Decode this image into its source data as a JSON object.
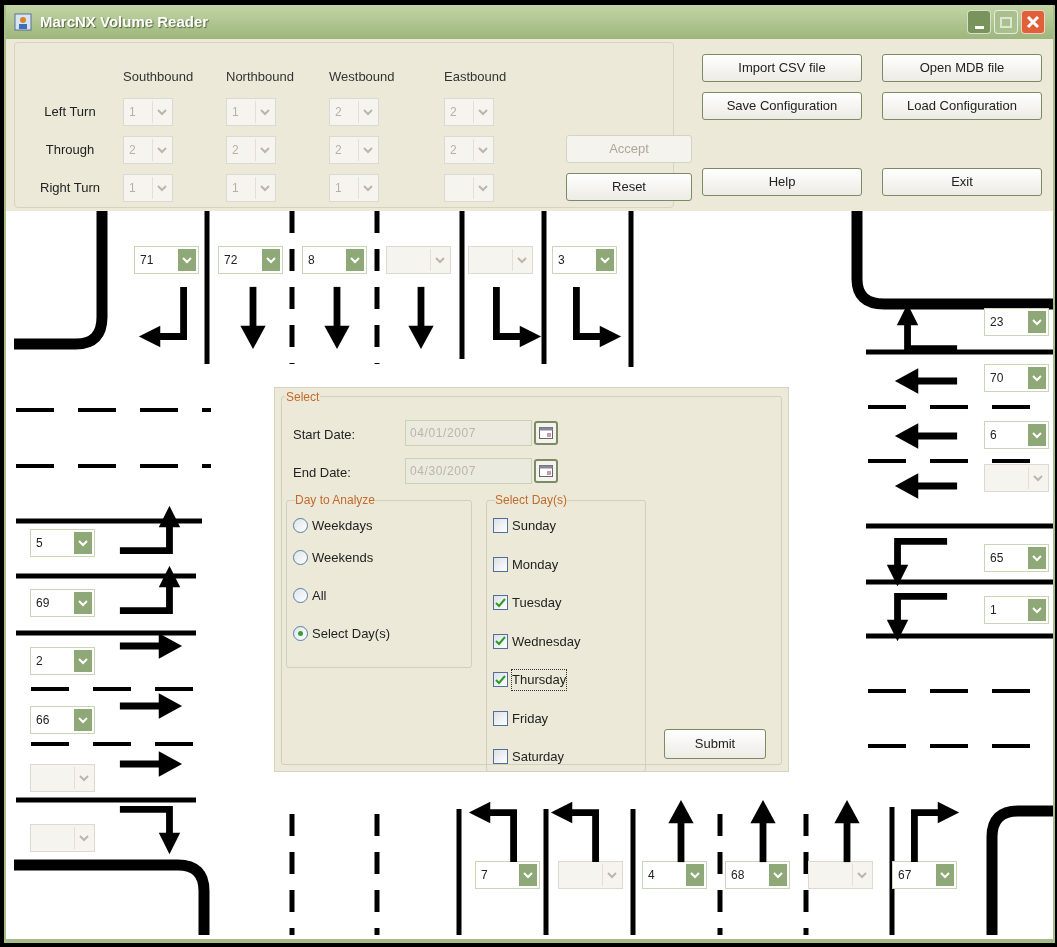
{
  "window": {
    "title": "MarcNX Volume Reader"
  },
  "lane_config": {
    "columns": [
      "Southbound",
      "Northbound",
      "Westbound",
      "Eastbound"
    ],
    "rows": [
      {
        "label": "Left Turn",
        "cells": [
          {
            "value": "1",
            "disabled": true
          },
          {
            "value": "1",
            "disabled": true
          },
          {
            "value": "2",
            "disabled": true
          },
          {
            "value": "2",
            "disabled": true
          }
        ]
      },
      {
        "label": "Through",
        "cells": [
          {
            "value": "2",
            "disabled": true
          },
          {
            "value": "2",
            "disabled": true
          },
          {
            "value": "2",
            "disabled": true
          },
          {
            "value": "2",
            "disabled": true
          }
        ]
      },
      {
        "label": "Right Turn",
        "cells": [
          {
            "value": "1",
            "disabled": true
          },
          {
            "value": "1",
            "disabled": true
          },
          {
            "value": "1",
            "disabled": true
          },
          {
            "disabled": true
          }
        ]
      }
    ]
  },
  "config_buttons": [
    {
      "label": "Accept",
      "disabled": true
    },
    {
      "label": "Reset",
      "disabled": false
    }
  ],
  "file_buttons": [
    {
      "label": "Import CSV file",
      "disabled": false
    },
    {
      "label": "Open MDB file",
      "disabled": false
    },
    {
      "label": "Save Configuration",
      "disabled": false
    },
    {
      "label": "Load Configuration",
      "disabled": false
    },
    {
      "label": "Help",
      "disabled": false
    },
    {
      "label": "Exit",
      "disabled": false
    }
  ],
  "approaches": [
    {
      "kind": "southbound",
      "lanes": [
        {
          "kind": "right",
          "value": "71",
          "disabled": false
        },
        {
          "kind": "through",
          "value": "72",
          "disabled": false
        },
        {
          "kind": "through",
          "value": "8",
          "disabled": false
        },
        {
          "kind": "through",
          "disabled": true
        },
        {
          "kind": "left",
          "disabled": true
        },
        {
          "kind": "left",
          "value": "3",
          "disabled": false
        }
      ]
    },
    {
      "kind": "westbound",
      "lanes": [
        {
          "kind": "right",
          "value": "23",
          "disabled": false
        },
        {
          "kind": "through",
          "value": "70",
          "disabled": false
        },
        {
          "kind": "through",
          "value": "6",
          "disabled": false
        },
        {
          "kind": "through",
          "disabled": true
        },
        {
          "kind": "left",
          "value": "65",
          "disabled": false
        },
        {
          "kind": "left",
          "value": "1",
          "disabled": false
        }
      ]
    },
    {
      "kind": "eastbound",
      "lanes": [
        {
          "kind": "left",
          "value": "5",
          "disabled": false
        },
        {
          "kind": "left",
          "value": "69",
          "disabled": false
        },
        {
          "kind": "through",
          "value": "2",
          "disabled": false
        },
        {
          "kind": "through",
          "value": "66",
          "disabled": false
        },
        {
          "kind": "through",
          "disabled": true
        },
        {
          "kind": "right",
          "disabled": true
        }
      ]
    },
    {
      "kind": "northbound",
      "lanes": [
        {
          "kind": "left",
          "value": "7",
          "disabled": false
        },
        {
          "kind": "left",
          "disabled": true
        },
        {
          "kind": "through",
          "value": "4",
          "disabled": false
        },
        {
          "kind": "through",
          "value": "68",
          "disabled": false
        },
        {
          "kind": "through",
          "disabled": true
        },
        {
          "kind": "right",
          "value": "67",
          "disabled": false
        }
      ]
    }
  ],
  "select_panel": {
    "title": "Select",
    "start_date": {
      "label": "Start Date:",
      "value": "04/01/2007",
      "disabled": true
    },
    "end_date": {
      "label": "End Date:",
      "value": "04/30/2007",
      "disabled": true
    },
    "day_to_analyze": {
      "title": "Day to Analyze",
      "options": [
        {
          "label": "Weekdays",
          "selected": false
        },
        {
          "label": "Weekends",
          "selected": false
        },
        {
          "label": "All",
          "selected": false
        },
        {
          "label": "Select Day(s)",
          "selected": true
        }
      ]
    },
    "select_days": {
      "title": "Select Day(s)",
      "days": [
        {
          "label": "Sunday",
          "checked": false,
          "focused": false
        },
        {
          "label": "Monday",
          "checked": false,
          "focused": false
        },
        {
          "label": "Tuesday",
          "checked": true,
          "focused": false
        },
        {
          "label": "Wednesday",
          "checked": true,
          "focused": false
        },
        {
          "label": "Thursday",
          "checked": true,
          "focused": true
        },
        {
          "label": "Friday",
          "checked": false,
          "focused": false
        },
        {
          "label": "Saturday",
          "checked": false,
          "focused": false
        }
      ]
    },
    "submit": {
      "label": "Submit",
      "disabled": false
    }
  }
}
